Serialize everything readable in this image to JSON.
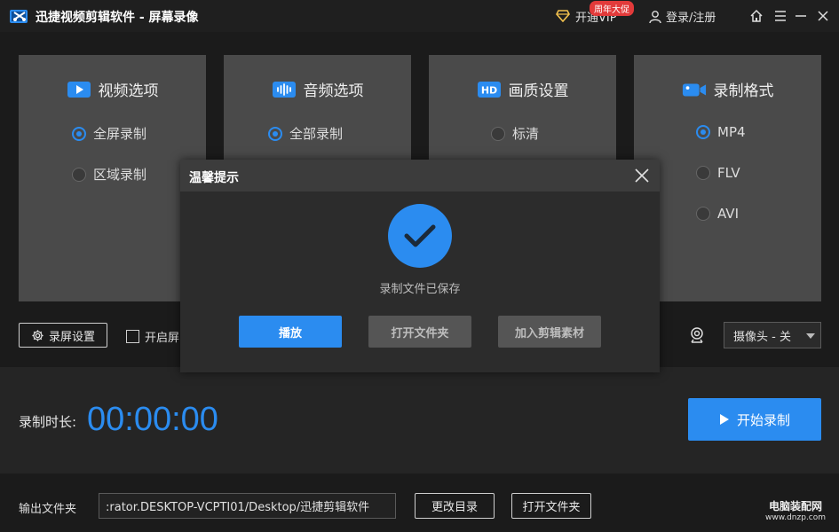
{
  "titlebar": {
    "title": "迅捷视频剪辑软件 - 屏幕录像",
    "vip_label": "开通VIP",
    "vip_badge": "周年大促",
    "login_label": "登录/注册"
  },
  "panels": [
    {
      "title": "视频选项",
      "icon": "video-play-icon",
      "options": [
        {
          "label": "全屏录制",
          "checked": true
        },
        {
          "label": "区域录制",
          "checked": false
        }
      ]
    },
    {
      "title": "音频选项",
      "icon": "audio-wave-icon",
      "options": [
        {
          "label": "全部录制",
          "checked": true
        }
      ]
    },
    {
      "title": "画质设置",
      "icon": "hd-icon",
      "icon_text": "HD",
      "options": [
        {
          "label": "标清",
          "checked": false
        }
      ]
    },
    {
      "title": "录制格式",
      "icon": "camera-format-icon",
      "options": [
        {
          "label": "MP4",
          "checked": true
        },
        {
          "label": "FLV",
          "checked": false
        },
        {
          "label": "AVI",
          "checked": false
        }
      ]
    }
  ],
  "settings": {
    "settings_button": "录屏设置",
    "checkbox_label": "开启屏",
    "camera_select": "摄像头 - 关"
  },
  "recording": {
    "time_label": "录制时长:",
    "time_value": "00:00:00",
    "start_button": "开始录制"
  },
  "footer": {
    "output_label": "输出文件夹",
    "path_value": ":rator.DESKTOP-VCPTI01/Desktop/迅捷剪辑软件",
    "change_dir_button": "更改目录",
    "open_folder_button": "打开文件夹"
  },
  "watermark": {
    "line1": "电脑装配网",
    "line2": "www.dnzp.com"
  },
  "modal": {
    "title": "温馨提示",
    "message": "录制文件已保存",
    "play_button": "播放",
    "open_folder_button": "打开文件夹",
    "add_material_button": "加入剪辑素材"
  },
  "colors": {
    "accent": "#2b8cf0",
    "panel_bg": "#4a4a4a",
    "app_bg": "#1b1b1b",
    "disabled_button": "#555555"
  }
}
